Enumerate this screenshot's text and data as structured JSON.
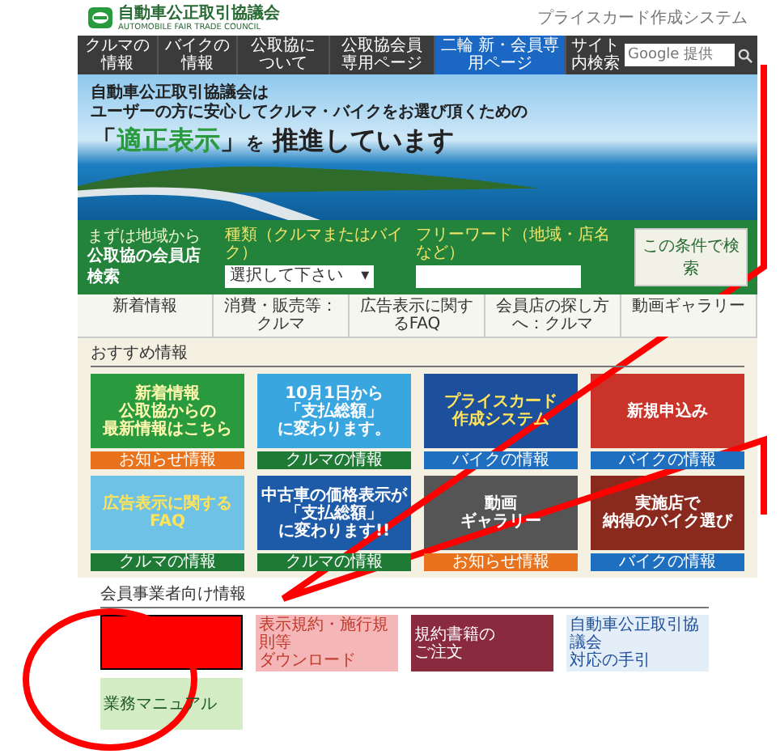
{
  "header": {
    "logo_title": "自動車公正取引協議会",
    "logo_subtitle": "AUTOMOBILE FAIR TRADE COUNCIL",
    "notice": "プライスカード作成システム"
  },
  "nav": {
    "items": [
      {
        "label": "クルマの情報",
        "selected": false
      },
      {
        "label": "バイクの情報",
        "selected": false
      },
      {
        "label": "公取協について",
        "selected": false
      },
      {
        "label": "公取協会員専用ページ",
        "selected": false
      },
      {
        "label": "二輪 新・会員専用ページ",
        "selected": true
      }
    ],
    "search": {
      "label": "サイト内検索",
      "placeholder": "Google 提供"
    }
  },
  "hero": {
    "lines": [
      "自動車公正取引協議会は",
      "ユーザーの方に安心してクルマ・バイクをお選び頂くための"
    ],
    "bracket_open": "「",
    "highlight": "適正表示",
    "bracket_close": "」",
    "particle": "を",
    "tail": "推進しています"
  },
  "shop_search": {
    "title_small": "まずは地域から",
    "title": "公取協の会員店検索",
    "type_label": "種類（クルマまたはバイク）",
    "type_value": "選択して下さい",
    "type_caret": "▾",
    "keyword_label": "フリーワード（地域・店名など）",
    "button": "この条件で検索"
  },
  "tabs": [
    {
      "label": "新着情報",
      "selected": false
    },
    {
      "label": "消費・販売等：クルマ",
      "selected": false
    },
    {
      "label": "広告表示に関するFAQ",
      "selected": false
    },
    {
      "label": "会員店の探し方へ：クルマ",
      "selected": false
    },
    {
      "label": "動画ギャラリー",
      "selected": false
    }
  ],
  "recommended": {
    "heading": "おすすめ情報",
    "tiles": [
      {
        "kind": "news",
        "lines": [
          "新着情報",
          "公取協からの",
          "最新情報はこちら"
        ],
        "category": "お知らせ情報",
        "color": "#e8731c"
      },
      {
        "kind": "campaign",
        "lines": [
          "10月1日から",
          "「支払総額」",
          "に変わります。"
        ],
        "category": "クルマの情報",
        "color": "#1e7a34"
      },
      {
        "kind": "system",
        "lines": [
          "プライスカード",
          "作成システム"
        ],
        "category": "バイクの情報",
        "color": "#1f6fc0"
      },
      {
        "kind": "signup",
        "lines": [
          "新規申込み"
        ],
        "category": "バイクの情報",
        "color": "#1f6fc0"
      },
      {
        "kind": "faq",
        "lines": [
          "広告表示に関する",
          "FAQ"
        ],
        "category": "クルマの情報",
        "color": "#1e7a34"
      },
      {
        "kind": "notice",
        "lines": [
          "中古車の価格表示が",
          "「支払総額」",
          "に変わります!!"
        ],
        "category": "クルマの情報",
        "color": "#1e7a34"
      },
      {
        "kind": "video",
        "lines": [
          "動画",
          "ギャラリー"
        ],
        "category": "お知らせ情報",
        "color": "#e8731c"
      },
      {
        "kind": "shop",
        "lines": [
          "実施店で",
          "納得のバイク選び"
        ],
        "category": "バイクの情報",
        "color": "#1f6fc0"
      }
    ]
  },
  "members": {
    "heading": "会員事業者向け情報",
    "banners": [
      {
        "kind": "redacted"
      },
      {
        "kind": "download",
        "lines": [
          "表示規約・施行規則等",
          "ダウンロード"
        ]
      },
      {
        "kind": "order",
        "lines": [
          "規約書籍の",
          "ご注文"
        ]
      },
      {
        "kind": "guide",
        "lines": [
          "自動車公正取引協議会",
          "対応の手引"
        ]
      },
      {
        "kind": "manual",
        "lines": [
          "業務マニュアル"
        ]
      }
    ]
  }
}
